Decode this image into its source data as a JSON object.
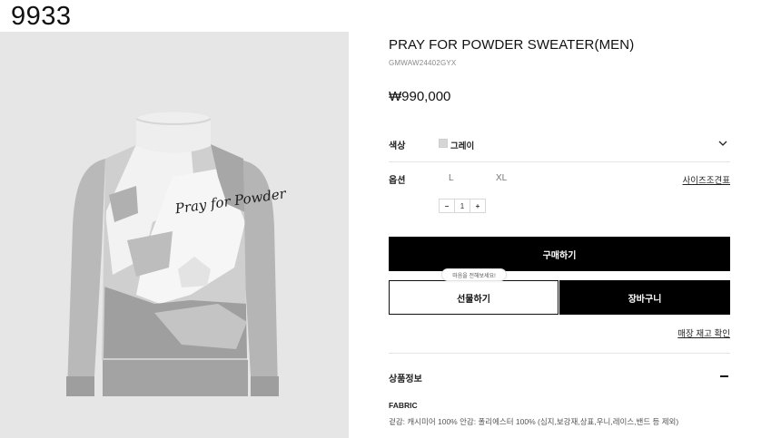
{
  "corner_label": "9933",
  "product": {
    "title": "PRAY FOR POWDER SWEATER(MEN)",
    "sku": "GMWAW24402GYX",
    "price": "₩990,000",
    "graphic_text": "Pray for Powder"
  },
  "color": {
    "label": "색상",
    "value": "그레이",
    "swatch_color": "#d6d6d6"
  },
  "option": {
    "label": "옵션",
    "sizes": [
      "L",
      "XL"
    ],
    "size_guide": "사이즈조견표"
  },
  "quantity": {
    "minus": "−",
    "value": "1",
    "plus": "+"
  },
  "actions": {
    "buy": "구매하기",
    "tooltip": "마음을 전해보세요!",
    "gift": "선물하기",
    "cart": "장바구니",
    "stock": "매장 재고 확인"
  },
  "info": {
    "title": "상품정보",
    "fabric_title": "FABRIC",
    "fabric_text": "겉감: 캐시미어 100% 안감: 폴리에스터 100% (심지,보강재,상표,우니,레이스,밴드 등 제외)"
  }
}
